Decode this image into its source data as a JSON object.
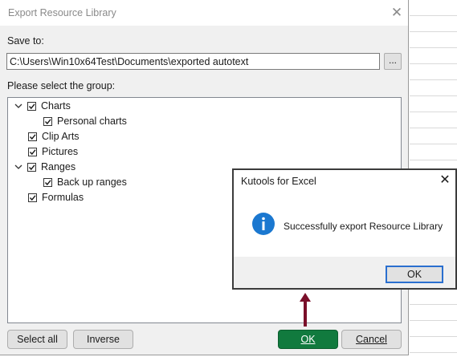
{
  "main_dialog": {
    "title": "Export Resource Library",
    "save_to_label": "Save to:",
    "save_path_value": "C:\\Users\\Win10x64Test\\Documents\\exported autotext",
    "browse_label": "...",
    "group_label": "Please select the group:",
    "tree": [
      {
        "label": "Charts",
        "checked": true,
        "expanded": true,
        "level": 0
      },
      {
        "label": "Personal charts",
        "checked": true,
        "level": 1
      },
      {
        "label": "Clip Arts",
        "checked": true,
        "level": 0
      },
      {
        "label": "Pictures",
        "checked": true,
        "level": 0
      },
      {
        "label": "Ranges",
        "checked": true,
        "expanded": true,
        "level": 0
      },
      {
        "label": "Back up ranges",
        "checked": true,
        "level": 1
      },
      {
        "label": "Formulas",
        "checked": true,
        "level": 0
      }
    ],
    "buttons": {
      "select_all": "Select all",
      "inverse": "Inverse",
      "ok": "OK",
      "cancel": "Cancel"
    }
  },
  "message_box": {
    "title": "Kutools for Excel",
    "message": "Successfully export Resource Library",
    "ok": "OK",
    "icon": "info-icon"
  },
  "colors": {
    "ok_button": "#117a3e",
    "info_icon": "#1b78d0",
    "arrow": "#7a0f2a"
  }
}
